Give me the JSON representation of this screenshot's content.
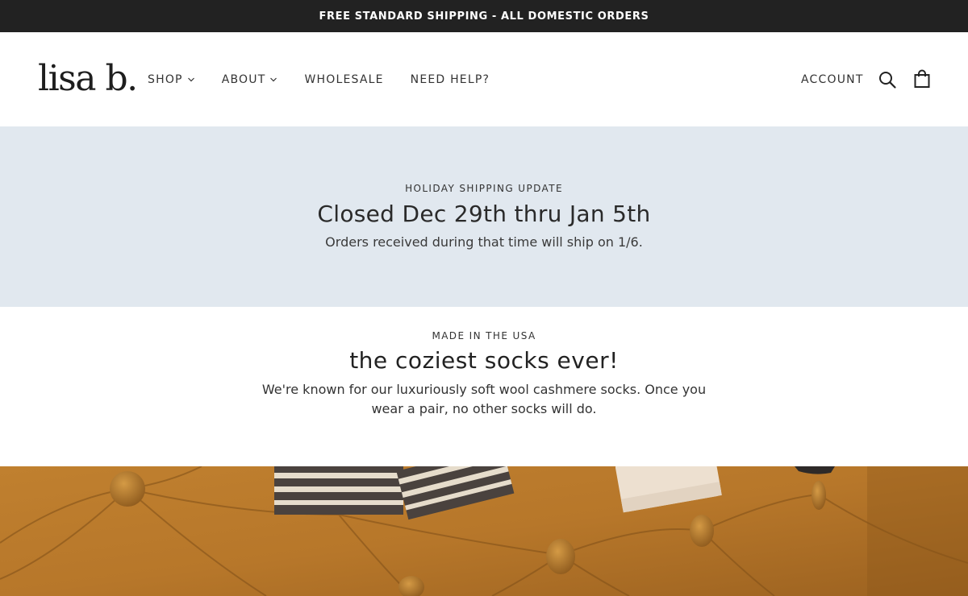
{
  "announcement": "FREE STANDARD SHIPPING - ALL DOMESTIC ORDERS",
  "header": {
    "logo": "lisa b.",
    "nav": [
      {
        "label": "SHOP",
        "has_dropdown": true
      },
      {
        "label": "ABOUT",
        "has_dropdown": true
      },
      {
        "label": "WHOLESALE",
        "has_dropdown": false
      },
      {
        "label": "NEED HELP?",
        "has_dropdown": false
      }
    ],
    "account": "ACCOUNT",
    "icons": [
      "search-icon",
      "shopping-bag-icon",
      "chevron-down-icon"
    ]
  },
  "holiday": {
    "eyebrow": "HOLIDAY SHIPPING UPDATE",
    "headline": "Closed Dec 29th thru Jan 5th",
    "subtext": "Orders received during that time will ship on 1/6."
  },
  "intro": {
    "eyebrow": "MADE IN THE USA",
    "headline": "the coziest socks ever!",
    "body": "We're known for our luxuriously soft wool cashmere socks. Once you wear a pair, no other socks will do."
  },
  "colors": {
    "announcement_bg": "#222222",
    "holiday_bg": "#e1e8ef",
    "leather": "#b8782a"
  }
}
